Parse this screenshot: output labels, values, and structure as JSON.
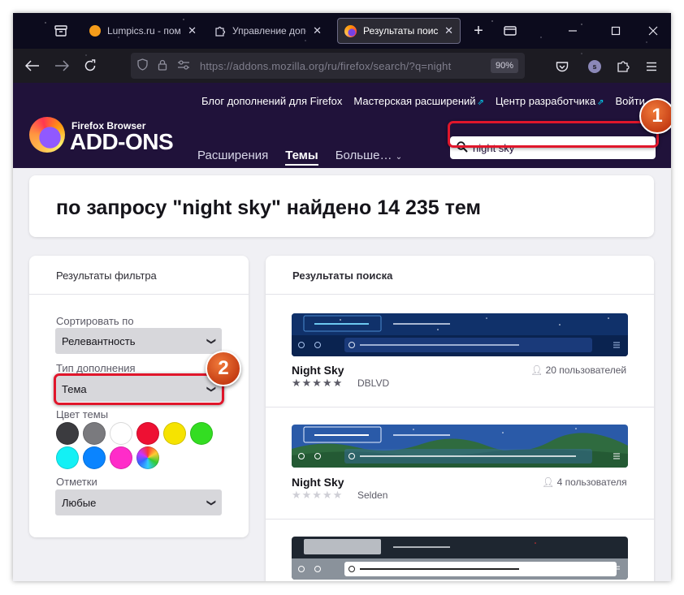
{
  "browser": {
    "tabs": [
      {
        "label": "Lumpics.ru - помощь",
        "close": "✕"
      },
      {
        "label": "Управление дополнениями",
        "close": "✕"
      },
      {
        "label": "Результаты поиска",
        "close": "✕"
      }
    ],
    "new_tab": "+",
    "url": "https://addons.mozilla.org/ru/firefox/search/?q=night",
    "zoom": "90%",
    "profile_initial": "s"
  },
  "header": {
    "links": [
      "Блог дополнений для Firefox",
      "Мастерская расширений",
      "Центр разработчика",
      "Войти"
    ],
    "logo_small": "Firefox Browser",
    "logo_big": "ADD-ONS",
    "nav": {
      "extensions": "Расширения",
      "themes": "Темы",
      "more": "Больше…"
    },
    "search_value": "night sky"
  },
  "results_heading": "по запросу \"night sky\" найдено 14 235 тем",
  "filters": {
    "title": "Результаты фильтра",
    "sort_label": "Сортировать по",
    "sort_value": "Релевантность",
    "type_label": "Тип дополнения",
    "type_value": "Тема",
    "color_label": "Цвет темы",
    "colors": [
      "#3b3b3f",
      "#7a7a7e",
      "#ffffff",
      "#ee1033",
      "#f6e300",
      "#33dd22",
      "#13f0f5",
      "#0a84ff",
      "#ff2cc9",
      "rainbow"
    ],
    "badge_label": "Отметки",
    "badge_value": "Любые"
  },
  "search_results": {
    "title": "Результаты поиска",
    "items": [
      {
        "name": "Night Sky",
        "users": "20 пользователей",
        "author": "DBLVD",
        "rating": 5
      },
      {
        "name": "Night Sky",
        "users": "4 пользователя",
        "author": "Selden",
        "rating": 0
      }
    ]
  },
  "callouts": {
    "one": "1",
    "two": "2"
  },
  "colors": {
    "header_bg": "#20123a",
    "highlight": "#e0162b",
    "callout": "#d9531e"
  }
}
